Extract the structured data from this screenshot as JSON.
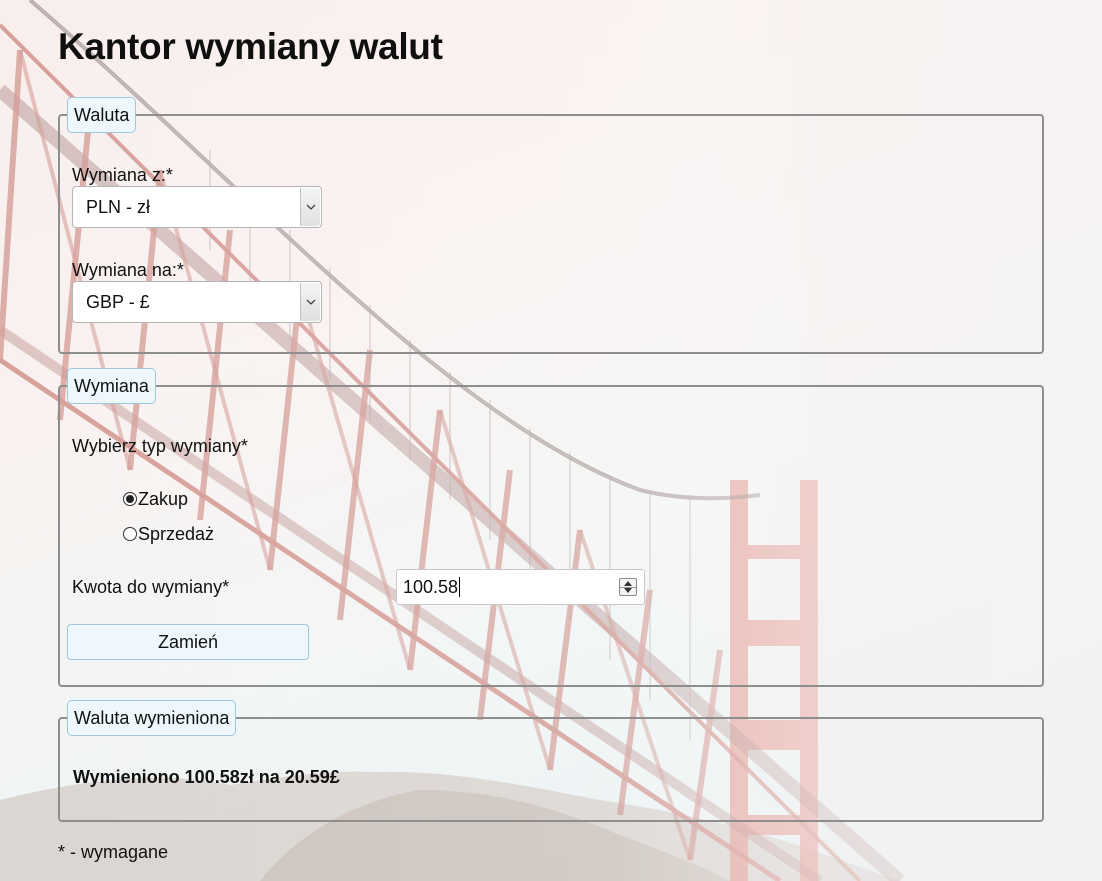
{
  "page_title": "Kantor wymiany walut",
  "currency_section": {
    "legend": "Waluta",
    "from_label": "Wymiana z:*",
    "from_value": "PLN - zł",
    "to_label": "Wymiana na:*",
    "to_value": "GBP - £"
  },
  "exchange_section": {
    "legend": "Wymiana",
    "type_label": "Wybierz typ wymiany*",
    "options": [
      "Zakup",
      "Sprzedaż"
    ],
    "selected_option": "Zakup",
    "amount_label": "Kwota do wymiany*",
    "amount_value": "100.58",
    "submit_label": "Zamień"
  },
  "result_section": {
    "legend": "Waluta wymieniona",
    "result_text": "Wymieniono 100.58zł na 20.59£"
  },
  "footnote": "* - wymagane",
  "colors": {
    "button_bg": "#eef7fc",
    "button_border": "#9cc8e0",
    "fieldset_border": "#8e8e8e",
    "bridge_red": "#c85a4c"
  },
  "icons": {
    "select_arrow": "chevron-down-icon",
    "spinner": "number-spinner-icon"
  }
}
